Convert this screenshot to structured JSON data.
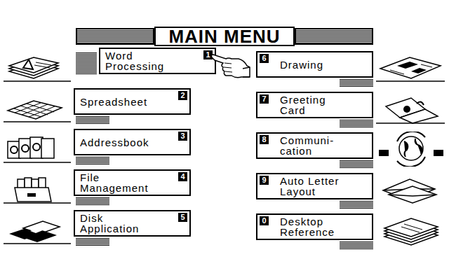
{
  "title": "MAIN MENU",
  "left_items": [
    {
      "lines": [
        "Word",
        "Processing"
      ],
      "key": "1",
      "selected": true
    },
    {
      "lines": [
        "Spreadsheet"
      ],
      "key": "2",
      "selected": false
    },
    {
      "lines": [
        "Addressbook"
      ],
      "key": "3",
      "selected": false
    },
    {
      "lines": [
        "File",
        "Management"
      ],
      "key": "4",
      "selected": false
    },
    {
      "lines": [
        "Disk",
        "Application"
      ],
      "key": "5",
      "selected": false
    }
  ],
  "right_items": [
    {
      "lines": [
        "Drawing"
      ],
      "key": "6",
      "selected": false
    },
    {
      "lines": [
        "Greeting",
        "Card"
      ],
      "key": "7",
      "selected": false
    },
    {
      "lines": [
        "Communi-",
        "cation"
      ],
      "key": "8",
      "selected": false
    },
    {
      "lines": [
        "Auto Letter",
        "Layout"
      ],
      "key": "9",
      "selected": false
    },
    {
      "lines": [
        "Desktop",
        "Reference"
      ],
      "key": "0",
      "selected": false
    }
  ]
}
